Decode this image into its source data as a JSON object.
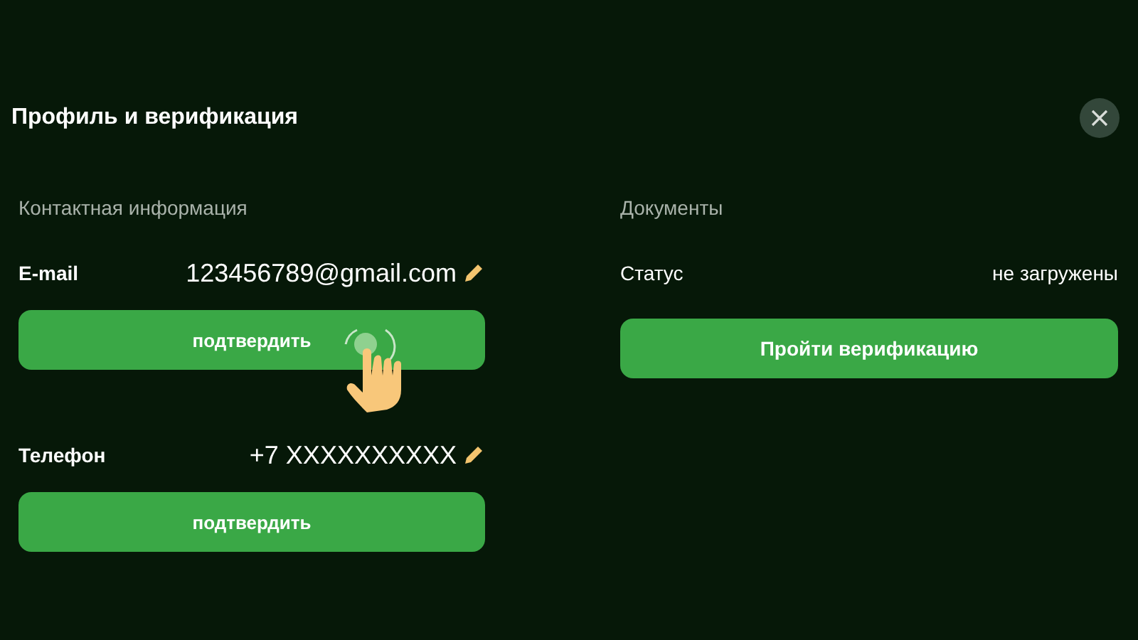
{
  "dialog": {
    "title": "Профиль и верификация"
  },
  "contacts": {
    "heading": "Контактная информация",
    "rows": [
      {
        "label": "E-mail",
        "value": "123456789@gmail.com",
        "button": "подтвердить",
        "pointer": true
      },
      {
        "label": "Телефон",
        "value": "+7 XXXXXXXXXX",
        "button": "подтвердить",
        "pointer": false
      }
    ]
  },
  "documents": {
    "heading": "Документы",
    "status_label": "Статус",
    "status_value": "не загружены",
    "button": "Пройти верификацию"
  }
}
